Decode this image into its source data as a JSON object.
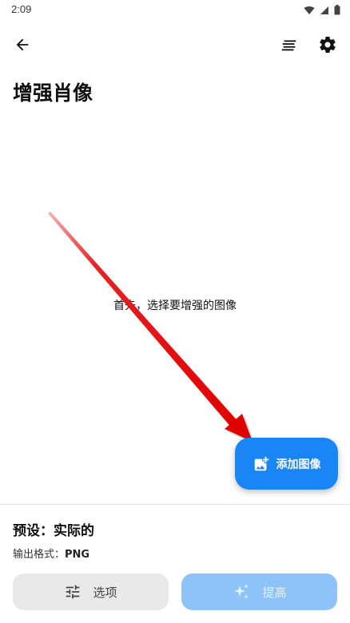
{
  "status_bar": {
    "time": "2:09",
    "icons": [
      "wifi-icon",
      "signal-icon",
      "battery-icon"
    ]
  },
  "top_bar": {
    "icons": [
      "back-arrow-icon",
      "sort-icon",
      "gear-icon"
    ]
  },
  "page": {
    "title": "增强肖像"
  },
  "main": {
    "empty_hint": "首先，选择要增强的图像"
  },
  "fab": {
    "label": "添加图像",
    "icon": "add-photo-icon",
    "color": "#1a86f5"
  },
  "settings": {
    "preset_label": "预设：",
    "preset_value": "实际的",
    "format_label": "输出格式：",
    "format_value": "PNG"
  },
  "bottom_buttons": {
    "options_label": "选项",
    "options_icon": "tune-icon",
    "enhance_label": "提高",
    "enhance_icon": "sparkle-icon",
    "enhance_color": "#8ec3fa"
  }
}
